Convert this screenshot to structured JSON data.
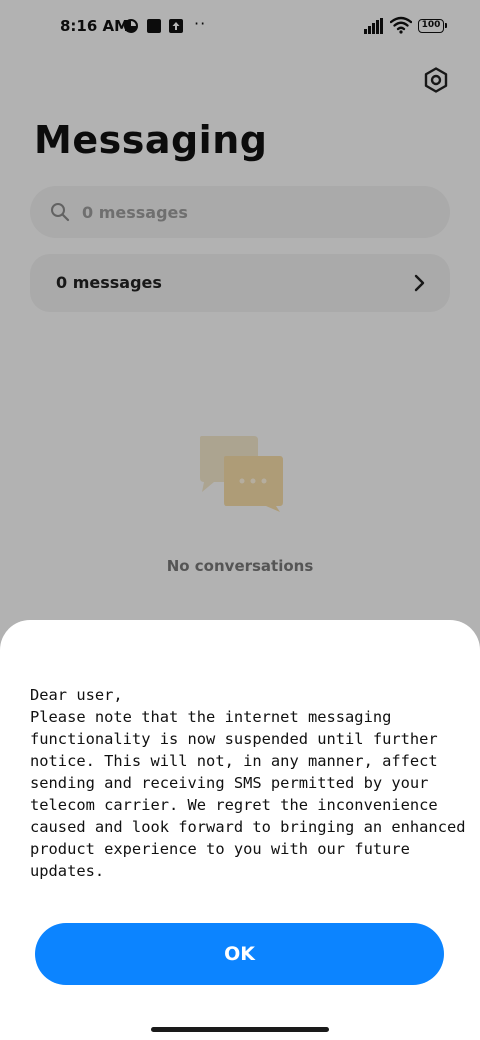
{
  "status_bar": {
    "time": "8:16 AM",
    "battery": "100",
    "dots": "··"
  },
  "header": {
    "title": "Messaging",
    "settings_icon": "settings-icon"
  },
  "search": {
    "placeholder": "0 messages"
  },
  "messages_row": {
    "label": "0 messages"
  },
  "empty_state": {
    "text": "No conversations",
    "icon": "chat-bubbles-icon"
  },
  "dialog": {
    "message": "Dear user,\nPlease note that the internet messaging functionality is now suspended until further notice. This will not, in any manner, affect sending and receiving SMS permitted by your telecom carrier. We regret the inconvenience caused and look forward to bringing an enhanced product experience to you with our future updates.",
    "ok_label": "OK"
  },
  "colors": {
    "accent": "#0c84ff",
    "empty_icon_back": "#efe3c8",
    "empty_icon_front": "#f2d9a6"
  }
}
